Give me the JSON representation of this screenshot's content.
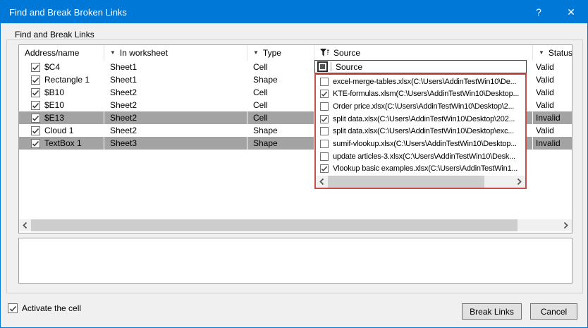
{
  "window": {
    "title": "Find and Break Broken Links",
    "help_glyph": "?",
    "close_glyph": "✕"
  },
  "group_label": "Find and Break Links",
  "table": {
    "columns": [
      {
        "label": "Address/name"
      },
      {
        "label": "In worksheet"
      },
      {
        "label": "Type"
      },
      {
        "label": "Source"
      },
      {
        "label": "Status"
      }
    ],
    "rows": [
      {
        "checked": true,
        "name": "$C4",
        "worksheet": "Sheet1",
        "type": "Cell",
        "status": "Valid",
        "highlighted": false
      },
      {
        "checked": true,
        "name": "Rectangle 1",
        "worksheet": "Sheet1",
        "type": "Shape",
        "status": "Valid",
        "highlighted": false
      },
      {
        "checked": true,
        "name": "$B10",
        "worksheet": "Sheet2",
        "type": "Cell",
        "status": "Valid",
        "highlighted": false
      },
      {
        "checked": true,
        "name": "$E10",
        "worksheet": "Sheet2",
        "type": "Cell",
        "status": "Valid",
        "highlighted": false
      },
      {
        "checked": true,
        "name": "$E13",
        "worksheet": "Sheet2",
        "type": "Cell",
        "status": "Invalid",
        "highlighted": true
      },
      {
        "checked": true,
        "name": "Cloud 1",
        "worksheet": "Sheet2",
        "type": "Shape",
        "status": "Valid",
        "highlighted": false
      },
      {
        "checked": true,
        "name": "TextBox 1",
        "worksheet": "Sheet3",
        "type": "Shape",
        "status": "Invalid",
        "highlighted": true
      }
    ]
  },
  "filter_popup": {
    "header_label": "Source",
    "items": [
      {
        "checked": false,
        "label": "excel-merge-tables.xlsx(C:\\Users\\AddinTestWin10\\De..."
      },
      {
        "checked": true,
        "label": "KTE-formulas.xlsm(C:\\Users\\AddinTestWin10\\Desktop..."
      },
      {
        "checked": false,
        "label": "Order price.xlsx(C:\\Users\\AddinTestWin10\\Desktop\\2..."
      },
      {
        "checked": true,
        "label": "split data.xlsx(C:\\Users\\AddinTestWin10\\Desktop\\202..."
      },
      {
        "checked": false,
        "label": "split data.xlsx(C:\\Users\\AddinTestWin10\\Desktop\\exc..."
      },
      {
        "checked": false,
        "label": "sumif-vlookup.xlsx(C:\\Users\\AddinTestWin10\\Desktop..."
      },
      {
        "checked": false,
        "label": "update articles-3.xlsx(C:\\Users\\AddinTestWin10\\Desk..."
      },
      {
        "checked": true,
        "label": "Vlookup basic examples.xlsx(C:\\Users\\AddinTestWin1..."
      }
    ]
  },
  "footer": {
    "activate_label": "Activate the cell",
    "break_label": "Break Links",
    "cancel_label": "Cancel"
  },
  "colors": {
    "titlebar": "#0078d7",
    "row_highlight": "#a3a3a3",
    "popup_border": "#c4504e",
    "dialog_bg": "#f0f0f0"
  }
}
